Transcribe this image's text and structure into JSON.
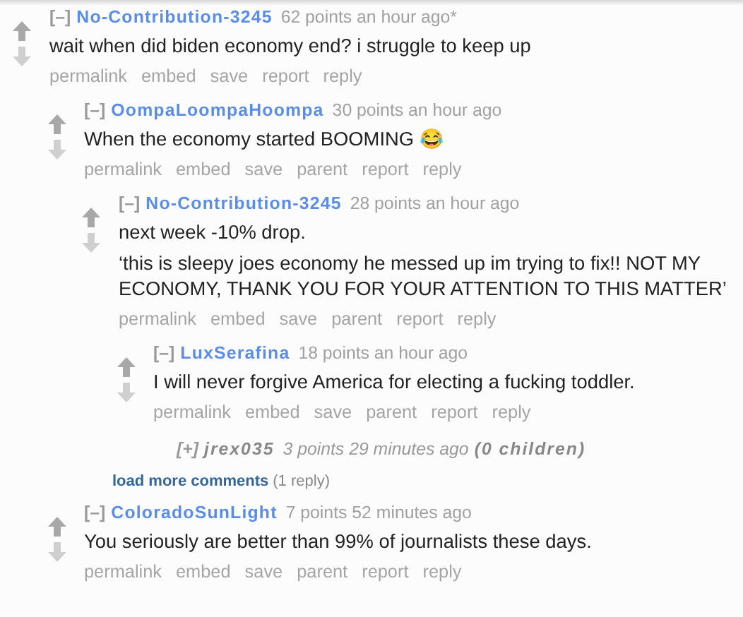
{
  "comments": [
    {
      "kind": "comment",
      "toggle": "[–]",
      "author": "No-Contribution-3245",
      "meta": "62 points an hour ago*",
      "body": [
        "wait when did biden economy end? i struggle to keep up"
      ],
      "actions": [
        "permalink",
        "embed",
        "save",
        "report",
        "reply"
      ],
      "children": [
        {
          "kind": "comment",
          "toggle": "[–]",
          "author": "OompaLoompaHoompa",
          "meta": "30 points an hour ago",
          "body": [
            "When the economy started BOOMING 😂"
          ],
          "actions": [
            "permalink",
            "embed",
            "save",
            "parent",
            "report",
            "reply"
          ],
          "children": [
            {
              "kind": "comment",
              "toggle": "[–]",
              "author": "No-Contribution-3245",
              "meta": "28 points an hour ago",
              "body": [
                "next week -10% drop.",
                "‘this is sleepy joes economy he messed up im trying to fix!! NOT MY ECONOMY, THANK YOU FOR YOUR ATTENTION TO THIS MATTER’"
              ],
              "actions": [
                "permalink",
                "embed",
                "save",
                "parent",
                "report",
                "reply"
              ],
              "children": [
                {
                  "kind": "comment",
                  "toggle": "[–]",
                  "author": "LuxSerafina",
                  "meta": "18 points an hour ago",
                  "body": [
                    "I will never forgive America for electing a fucking toddler."
                  ],
                  "actions": [
                    "permalink",
                    "embed",
                    "save",
                    "parent",
                    "report",
                    "reply"
                  ],
                  "children": [
                    {
                      "kind": "collapsed",
                      "toggle": "[+]",
                      "author": "jrex035",
                      "meta": "3 points 29 minutes ago",
                      "children_count": "(0 children)"
                    }
                  ]
                },
                {
                  "kind": "more",
                  "link": "load more comments",
                  "count": "(1 reply)"
                }
              ]
            }
          ]
        },
        {
          "kind": "comment",
          "toggle": "[–]",
          "author": "ColoradoSunLight",
          "meta": "7 points 52 minutes ago",
          "body": [
            "You seriously are better than 99% of journalists these days."
          ],
          "actions": [
            "permalink",
            "embed",
            "save",
            "parent",
            "report",
            "reply"
          ]
        }
      ]
    }
  ]
}
